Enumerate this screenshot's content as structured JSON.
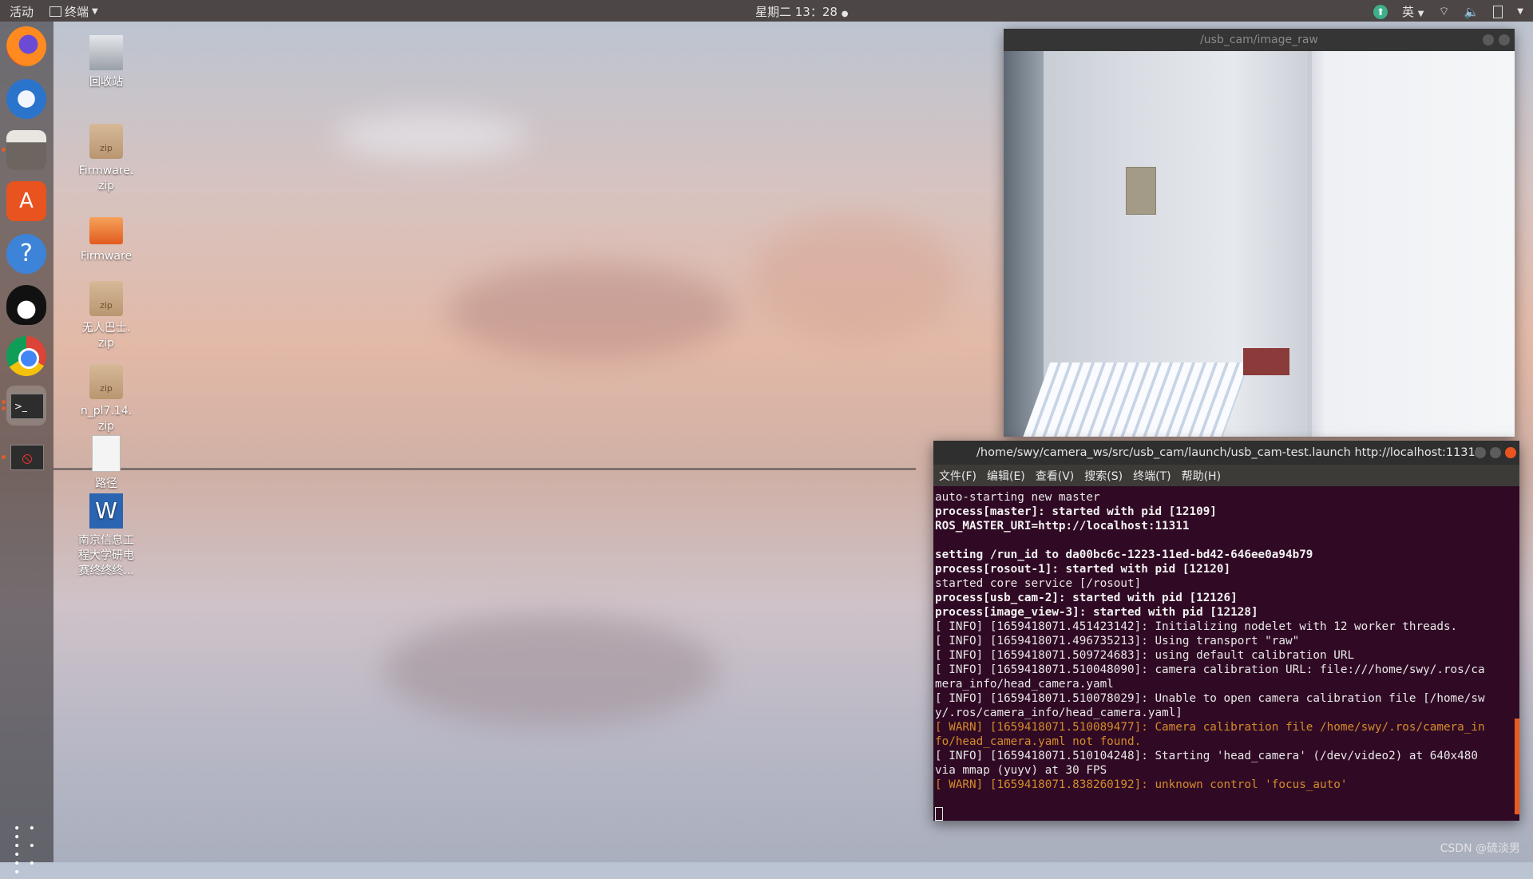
{
  "topbar": {
    "activities": "活动",
    "app_menu": "终端",
    "clock": "星期二 13：28",
    "input_method": "英"
  },
  "dock": {
    "items": [
      "firefox-icon",
      "thunderbird-icon",
      "files-icon",
      "software-icon",
      "help-icon",
      "qq-icon",
      "chrome-icon",
      "terminal-icon",
      "blocked-app-icon"
    ],
    "show_apps": "show-apps-icon"
  },
  "desktop": {
    "icons": [
      {
        "label": "回收站",
        "type": "trash"
      },
      {
        "label": "Firmware.\nzip",
        "type": "zip"
      },
      {
        "label": "Firmware",
        "type": "folder"
      },
      {
        "label": "无人巴士.\nzip",
        "type": "zip"
      },
      {
        "label": "n_pl7.14.\nzip",
        "type": "zip"
      },
      {
        "label": "路径",
        "type": "text"
      },
      {
        "label": "南京信息工\n程大学研电\n赛终终终...",
        "type": "word"
      }
    ]
  },
  "camera_window": {
    "title": "/usb_cam/image_raw"
  },
  "terminal": {
    "title": "/home/swy/camera_ws/src/usb_cam/launch/usb_cam-test.launch http://localhost:11311",
    "menu": [
      "文件(F)",
      "编辑(E)",
      "查看(V)",
      "搜索(S)",
      "终端(T)",
      "帮助(H)"
    ],
    "lines": [
      {
        "t": "auto-starting new master",
        "s": "n"
      },
      {
        "t": "process[master]: started with pid [12109]",
        "s": "b"
      },
      {
        "t": "ROS_MASTER_URI=http://localhost:11311",
        "s": "b"
      },
      {
        "t": "",
        "s": "n"
      },
      {
        "t": "setting /run_id to da00bc6c-1223-11ed-bd42-646ee0a94b79",
        "s": "b"
      },
      {
        "t": "process[rosout-1]: started with pid [12120]",
        "s": "b"
      },
      {
        "t": "started core service [/rosout]",
        "s": "n"
      },
      {
        "t": "process[usb_cam-2]: started with pid [12126]",
        "s": "b"
      },
      {
        "t": "process[image_view-3]: started with pid [12128]",
        "s": "b"
      },
      {
        "t": "[ INFO] [1659418071.451423142]: Initializing nodelet with 12 worker threads.",
        "s": "n"
      },
      {
        "t": "[ INFO] [1659418071.496735213]: Using transport \"raw\"",
        "s": "n"
      },
      {
        "t": "[ INFO] [1659418071.509724683]: using default calibration URL",
        "s": "n"
      },
      {
        "t": "[ INFO] [1659418071.510048090]: camera calibration URL: file:///home/swy/.ros/ca",
        "s": "n"
      },
      {
        "t": "mera_info/head_camera.yaml",
        "s": "n"
      },
      {
        "t": "[ INFO] [1659418071.510078029]: Unable to open camera calibration file [/home/sw",
        "s": "n"
      },
      {
        "t": "y/.ros/camera_info/head_camera.yaml]",
        "s": "n"
      },
      {
        "t": "[ WARN] [1659418071.510089477]: Camera calibration file /home/swy/.ros/camera_in",
        "s": "w"
      },
      {
        "t": "fo/head_camera.yaml not found.",
        "s": "w"
      },
      {
        "t": "[ INFO] [1659418071.510104248]: Starting 'head_camera' (/dev/video2) at 640x480",
        "s": "n"
      },
      {
        "t": "via mmap (yuyv) at 30 FPS",
        "s": "n"
      },
      {
        "t": "[ WARN] [1659418071.838260192]: unknown control 'focus_auto'",
        "s": "w"
      }
    ]
  },
  "watermark": "CSDN @硫淡男"
}
